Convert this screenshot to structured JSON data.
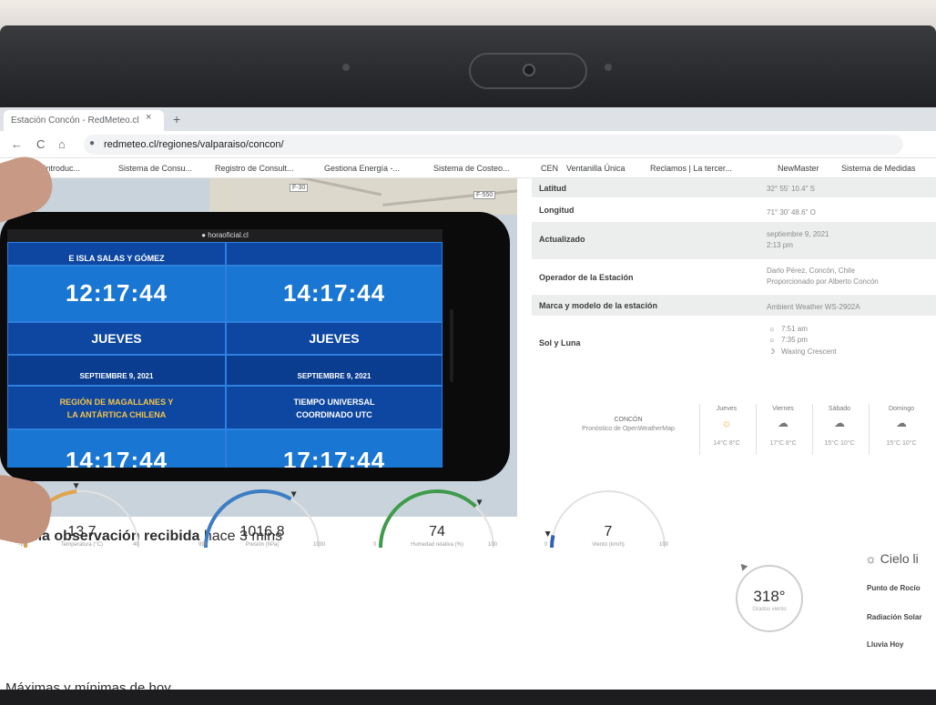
{
  "browser": {
    "tab_title": "Estación Concón - RedMeteo.cl",
    "tab_close": "×",
    "tab_new": "+",
    "back_icon": "←",
    "reload_icon": "C",
    "home_icon": "⌂",
    "url": "redmeteo.cl/regiones/valparaiso/concon/",
    "bookmarks": [
      "Módulo 1: Introduc...",
      "Sistema de Consu...",
      "Registro de Consult...",
      "Gestiona Energía -...",
      "Sistema de Costeo...",
      "CEN",
      "Ventanilla Única",
      "Reclamos | La tercer...",
      "NewMaster",
      "Sistema de Medidas"
    ]
  },
  "map": {
    "badges": [
      "F-30",
      "F-550"
    ]
  },
  "station_info": [
    {
      "label": "Latitud",
      "value": "32° 55' 10.4\" S"
    },
    {
      "label": "Longitud",
      "value": "71° 30' 48.6\" O"
    },
    {
      "label": "Actualizado",
      "value": "septiembre 9, 2021",
      "value2": "2:13 pm"
    },
    {
      "label": "Operador de la Estación",
      "value": "Darlo Pérez, Concón, Chile",
      "value2": "Proporcionado por Alberto Concón"
    },
    {
      "label": "Marca y modelo de la estación",
      "value": "Ambient Weather WS-2902A"
    },
    {
      "label": "Sol y Luna",
      "value": "7:51 am",
      "value2": "7:35 pm",
      "value3": "Waxing Crescent"
    }
  ],
  "forecast": {
    "city": "CONCÓN",
    "source": "Pronóstico de OpenWeatherMap",
    "days": [
      {
        "name": "Jueves",
        "icon": "☼",
        "temps": "14°C  8°C"
      },
      {
        "name": "Viernes",
        "icon": "☁",
        "temps": "17°C  8°C"
      },
      {
        "name": "Sábado",
        "icon": "☁",
        "temps": "15°C  10°C"
      },
      {
        "name": "Domingo",
        "icon": "☁",
        "temps": "15°C  10°C"
      }
    ]
  },
  "observation": {
    "title_bold": "Ultima observación recibida",
    "title_rest": " hace 3 mins"
  },
  "gauges": [
    {
      "value": "13.7",
      "label": "Temperatura (°C)",
      "min": "-10",
      "max": "40",
      "fraction": 0.47,
      "color": "#e0a44a"
    },
    {
      "value": "1016.8",
      "label": "Presión (hPa)",
      "min": "990",
      "max": "1030",
      "fraction": 0.67,
      "color": "#3c7dc4"
    },
    {
      "value": "74",
      "label": "Humedad relativa (%)",
      "min": "0",
      "max": "100",
      "fraction": 0.74,
      "color": "#3e9b4a"
    },
    {
      "value": "7",
      "label": "Viento (km/h)",
      "min": "0",
      "max": "100",
      "fraction": 0.07,
      "color": "#3161b3"
    }
  ],
  "wind": {
    "degrees": "318°",
    "sub": "Grados viento"
  },
  "conditions": {
    "sky_icon": "☼",
    "sky": "Cielo li",
    "dew_point": "Punto de Rocío",
    "solar": "Radiación Solar",
    "rain": "Lluvia Hoy"
  },
  "max_min_title": "Máximas y mínimas de hoy",
  "phone": {
    "status_url": "horaoficial.cl",
    "left": {
      "zone_top": "E ISLA SALAS Y GÓMEZ",
      "time": "12:17:44",
      "day": "JUEVES",
      "date": "SEPTIEMBRE 9, 2021",
      "zone_bottom_1": "REGIÓN DE MAGALLANES Y",
      "zone_bottom_2": "LA ANTÁRTICA CHILENA",
      "time_bottom": "14:17:44"
    },
    "right": {
      "time": "14:17:44",
      "day": "JUEVES",
      "date": "SEPTIEMBRE 9, 2021",
      "zone_bottom_1": "TIEMPO UNIVERSAL",
      "zone_bottom_2": "COORDINADO UTC",
      "time_bottom": "17:17:44"
    }
  }
}
